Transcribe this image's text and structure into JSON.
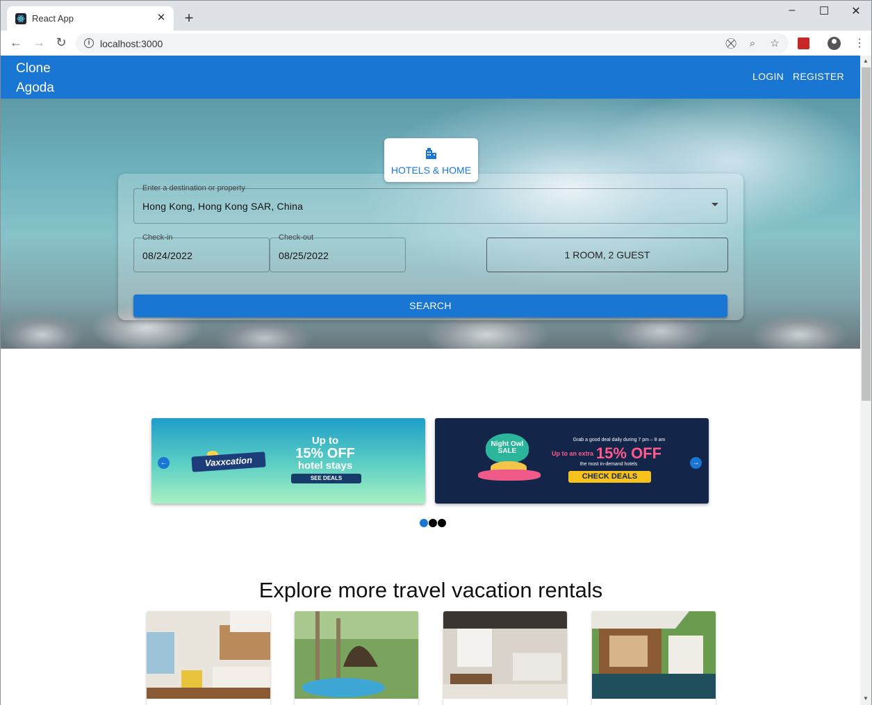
{
  "browser": {
    "tab_title": "React App",
    "url": "localhost:3000",
    "close_glyph": "✕",
    "new_tab_glyph": "+"
  },
  "appbar": {
    "brand_line1": "Clone",
    "brand_line2": "Agoda",
    "login": "LOGIN",
    "register": "REGISTER",
    "color": "#1976d2"
  },
  "search": {
    "tab_label": "HOTELS & HOME",
    "destination_label": "Enter a destination or property",
    "destination_value": "Hong Kong, Hong Kong SAR, China",
    "checkin_label": "Check-in",
    "checkin_value": "08/24/2022",
    "checkout_label": "Check-out",
    "checkout_value": "08/25/2022",
    "rooms_label": "1 ROOM, 2 GUEST",
    "search_button": "SEARCH"
  },
  "promos": {
    "banner1": {
      "logo": "Vaxxcation",
      "line1": "Up to",
      "line2": "15% OFF",
      "line3": "hotel stays",
      "button": "SEE DEALS"
    },
    "banner2": {
      "badge": "Night Owl SALE",
      "caption": "Grab a good deal daily during 7 pm – 8 am",
      "prefix": "Up to an extra",
      "headline": "15% OFF",
      "subcaption": "the most in-demand hotels",
      "button": "CHECK DEALS"
    },
    "active_dot": 0,
    "dot_count": 3
  },
  "rentals": {
    "title": "Explore more travel vacation rentals",
    "cards": [
      {
        "name": "apartment-kitchen"
      },
      {
        "name": "tropical-villa"
      },
      {
        "name": "loft-living-room"
      },
      {
        "name": "pool-villa"
      }
    ]
  }
}
